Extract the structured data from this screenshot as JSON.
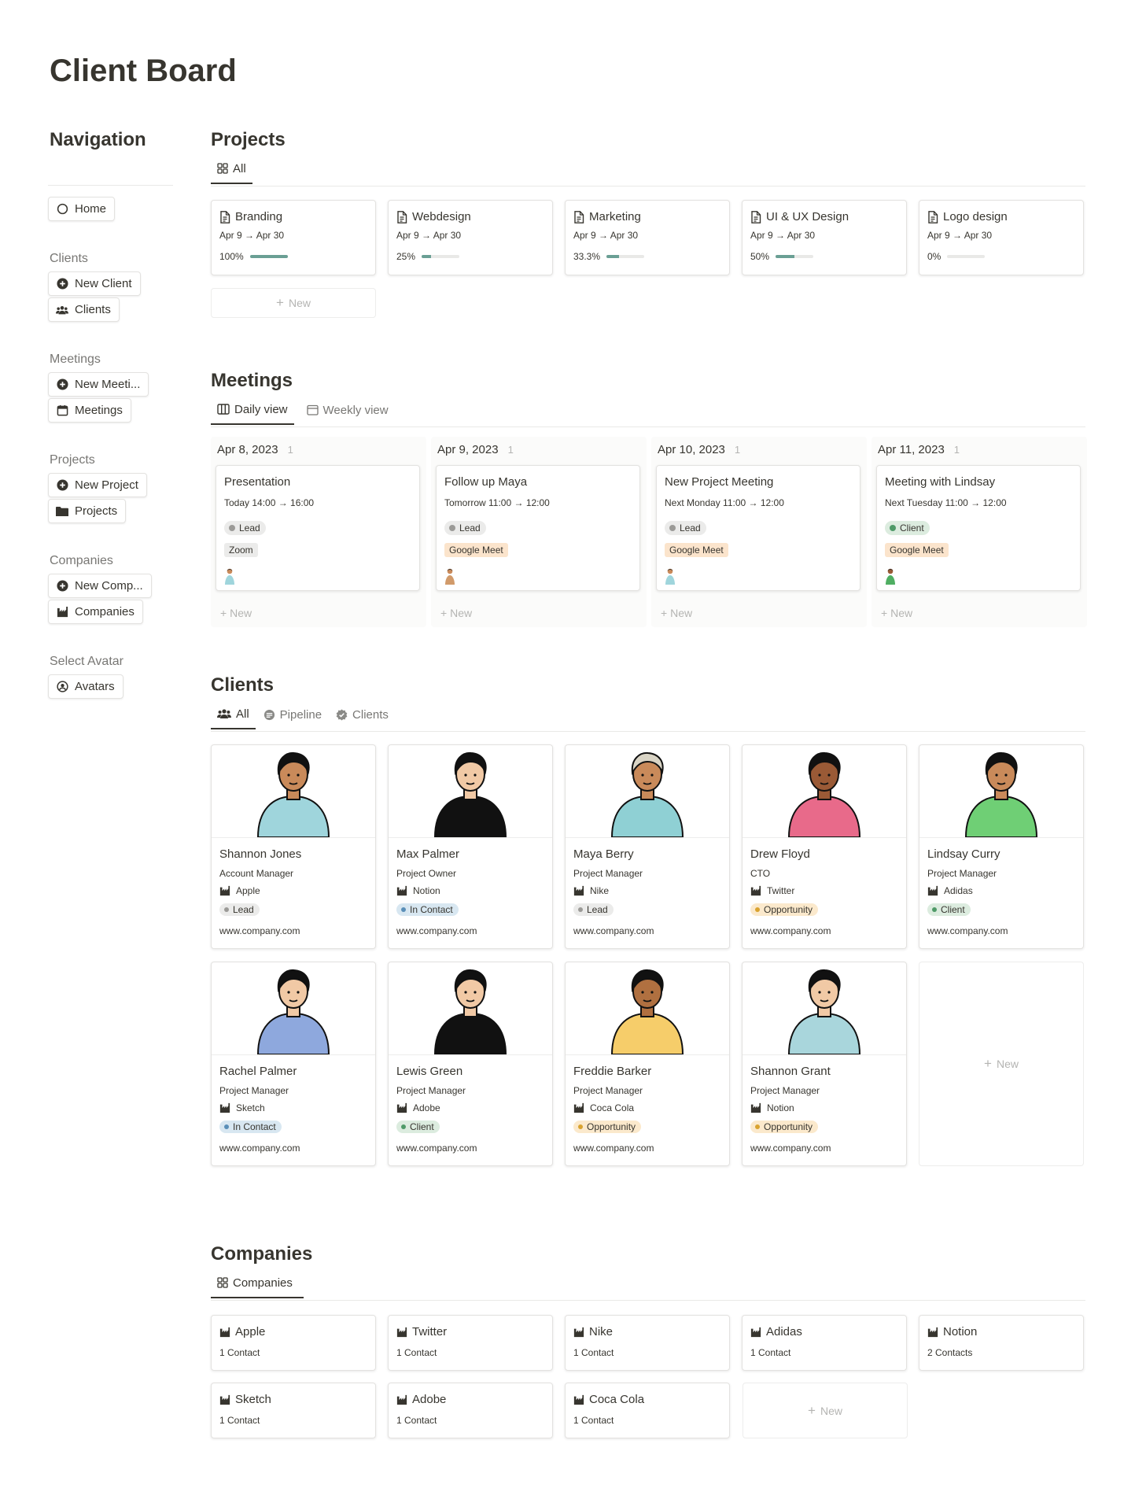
{
  "page": {
    "title": "Client Board"
  },
  "nav": {
    "heading": "Navigation",
    "home": "Home",
    "clients_label": "Clients",
    "new_client": "New Client",
    "clients": "Clients",
    "meetings_label": "Meetings",
    "new_meeting": "New Meeti...",
    "meetings": "Meetings",
    "projects_label": "Projects",
    "new_project": "New Project",
    "projects": "Projects",
    "companies_label": "Companies",
    "new_company": "New Comp...",
    "companies": "Companies",
    "avatar_label": "Select Avatar",
    "avatars": "Avatars"
  },
  "projects": {
    "heading": "Projects",
    "tab_all": "All",
    "new": "New",
    "items": [
      {
        "name": "Branding",
        "dates": "Apr 9 → Apr 30",
        "progress_label": "100%",
        "progress": 1.0
      },
      {
        "name": "Webdesign",
        "dates": "Apr 9 → Apr 30",
        "progress_label": "25%",
        "progress": 0.25
      },
      {
        "name": "Marketing",
        "dates": "Apr 9 → Apr 30",
        "progress_label": "33.3%",
        "progress": 0.333
      },
      {
        "name": "UI & UX Design",
        "dates": "Apr 9 → Apr 30",
        "progress_label": "50%",
        "progress": 0.5
      },
      {
        "name": "Logo design",
        "dates": "Apr 9 → Apr 30",
        "progress_label": "0%",
        "progress": 0
      }
    ]
  },
  "meetings": {
    "heading": "Meetings",
    "tab_daily": "Daily view",
    "tab_weekly": "Weekly view",
    "new": "New",
    "columns": [
      {
        "date": "Apr 8, 2023",
        "count": "1",
        "title": "Presentation",
        "time": "Today 14:00 → 16:00",
        "status": "Lead",
        "platform": "Zoom"
      },
      {
        "date": "Apr 9, 2023",
        "count": "1",
        "title": "Follow up Maya",
        "time": "Tomorrow 11:00 → 12:00",
        "status": "Lead",
        "platform": "Google Meet"
      },
      {
        "date": "Apr 10, 2023",
        "count": "1",
        "title": "New Project Meeting",
        "time": "Next Monday 11:00 → 12:00",
        "status": "Lead",
        "platform": "Google Meet"
      },
      {
        "date": "Apr 11, 2023",
        "count": "1",
        "title": "Meeting with Lindsay",
        "time": "Next Tuesday 11:00 → 12:00",
        "status": "Client",
        "platform": "Google Meet"
      }
    ]
  },
  "clients": {
    "heading": "Clients",
    "tab_all": "All",
    "tab_pipeline": "Pipeline",
    "tab_clients": "Clients",
    "new": "New",
    "items": [
      {
        "name": "Shannon Jones",
        "role": "Account Manager",
        "company": "Apple",
        "status": "Lead",
        "web": "www.company.com",
        "shirt": "#9fd5dc",
        "skin": "#c98a5a",
        "hair": "#111111"
      },
      {
        "name": "Max Palmer",
        "role": "Project Owner",
        "company": "Notion",
        "status": "In Contact",
        "web": "www.company.com",
        "shirt": "#111111",
        "skin": "#f1c9a5",
        "hair": "#111111"
      },
      {
        "name": "Maya Berry",
        "role": "Project Manager",
        "company": "Nike",
        "status": "Lead",
        "web": "www.company.com",
        "shirt": "#8fd0d4",
        "skin": "#c98a5a",
        "hair": "#d9d4c5"
      },
      {
        "name": "Drew Floyd",
        "role": "CTO",
        "company": "Twitter",
        "status": "Opportunity",
        "web": "www.company.com",
        "shirt": "#e86a8a",
        "skin": "#9a5a36",
        "hair": "#111111"
      },
      {
        "name": "Lindsay Curry",
        "role": "Project Manager",
        "company": "Adidas",
        "status": "Client",
        "web": "www.company.com",
        "shirt": "#6fcf75",
        "skin": "#c98a5a",
        "hair": "#111111"
      },
      {
        "name": "Rachel Palmer",
        "role": "Project Manager",
        "company": "Sketch",
        "status": "In Contact",
        "web": "www.company.com",
        "shirt": "#8ea8dd",
        "skin": "#f1c9a5",
        "hair": "#111111"
      },
      {
        "name": "Lewis Green",
        "role": "Project Manager",
        "company": "Adobe",
        "status": "Client",
        "web": "www.company.com",
        "shirt": "#111111",
        "skin": "#f1c9a5",
        "hair": "#111111"
      },
      {
        "name": "Freddie Barker",
        "role": "Project Manager",
        "company": "Coca Cola",
        "status": "Opportunity",
        "web": "www.company.com",
        "shirt": "#f6cd6a",
        "skin": "#b07040",
        "hair": "#111111"
      },
      {
        "name": "Shannon Grant",
        "role": "Project Manager",
        "company": "Notion",
        "status": "Opportunity",
        "web": "www.company.com",
        "shirt": "#a9d6dc",
        "skin": "#f1c9a5",
        "hair": "#111111"
      }
    ]
  },
  "companies": {
    "heading": "Companies",
    "tab": "Companies",
    "new": "New",
    "items": [
      {
        "name": "Apple",
        "contacts": "1 Contact"
      },
      {
        "name": "Twitter",
        "contacts": "1 Contact"
      },
      {
        "name": "Nike",
        "contacts": "1 Contact"
      },
      {
        "name": "Adidas",
        "contacts": "1 Contact"
      },
      {
        "name": "Notion",
        "contacts": "2 Contacts"
      },
      {
        "name": "Sketch",
        "contacts": "1 Contact"
      },
      {
        "name": "Adobe",
        "contacts": "1 Contact"
      },
      {
        "name": "Coca Cola",
        "contacts": "1 Contact"
      }
    ]
  },
  "status_colors": {
    "Lead": {
      "bg": "#ebebea",
      "dot": "#9b9a97"
    },
    "In Contact": {
      "bg": "#d8e7f1",
      "dot": "#5a8fb8"
    },
    "Opportunity": {
      "bg": "#fbe9cc",
      "dot": "#d9a330"
    },
    "Client": {
      "bg": "#dcecdf",
      "dot": "#4f9a68"
    }
  },
  "platform_colors": {
    "Zoom": "#ebebea",
    "Google Meet": "#fbe4cc"
  }
}
